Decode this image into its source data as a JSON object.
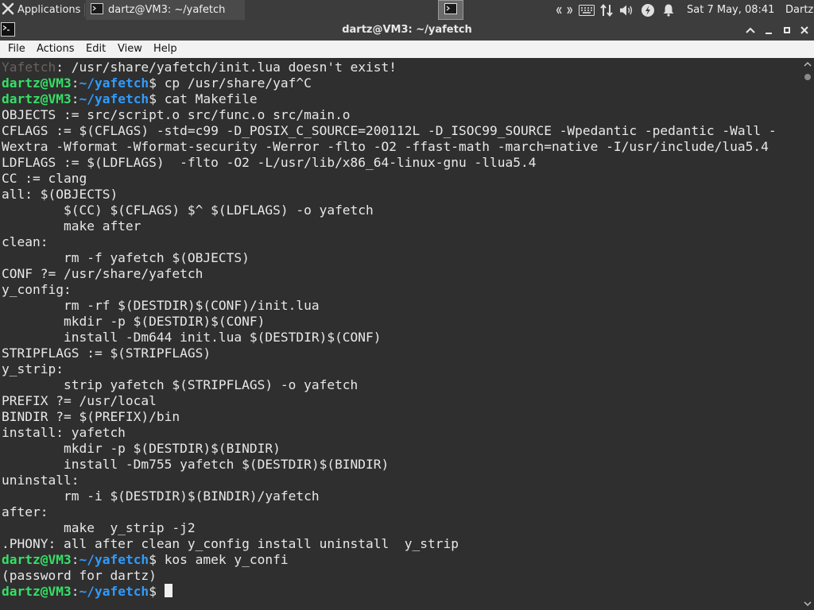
{
  "panel": {
    "apps_label": "Applications",
    "task_label": "dartz@VM3: ~/yafetch",
    "clock": "Sat  7 May, 08:41",
    "user": "Dartz"
  },
  "window": {
    "title": "dartz@VM3: ~/yafetch"
  },
  "menu": {
    "items": [
      "File",
      "Actions",
      "Edit",
      "View",
      "Help"
    ]
  },
  "terminal": {
    "prompt_user": "dartz@VM3",
    "prompt_sep": ":",
    "prompt_path": "~/yafetch",
    "prompt_end": "$ ",
    "lines": [
      {
        "type": "error",
        "prefix": "Yafetch",
        "text": ": /usr/share/yafetch/init.lua doesn't exist!"
      },
      {
        "type": "prompt",
        "text": "cp /usr/share/yaf^C"
      },
      {
        "type": "prompt",
        "text": "cat Makefile"
      },
      {
        "type": "out",
        "text": "OBJECTS := src/script.o src/func.o src/main.o"
      },
      {
        "type": "out",
        "text": "CFLAGS := $(CFLAGS) -std=c99 -D_POSIX_C_SOURCE=200112L -D_ISOC99_SOURCE -Wpedantic -pedantic -Wall -"
      },
      {
        "type": "out",
        "text": "Wextra -Wformat -Wformat-security -Werror -flto -O2 -ffast-math -march=native -I/usr/include/lua5.4"
      },
      {
        "type": "out",
        "text": "LDFLAGS := $(LDFLAGS)  -flto -O2 -L/usr/lib/x86_64-linux-gnu -llua5.4"
      },
      {
        "type": "out",
        "text": "CC := clang"
      },
      {
        "type": "out",
        "text": "all: $(OBJECTS)"
      },
      {
        "type": "out",
        "text": "        $(CC) $(CFLAGS) $^ $(LDFLAGS) -o yafetch"
      },
      {
        "type": "out",
        "text": "        make after"
      },
      {
        "type": "out",
        "text": "clean:"
      },
      {
        "type": "out",
        "text": "        rm -f yafetch $(OBJECTS)"
      },
      {
        "type": "out",
        "text": "CONF ?= /usr/share/yafetch"
      },
      {
        "type": "out",
        "text": "y_config:"
      },
      {
        "type": "out",
        "text": "        rm -rf $(DESTDIR)$(CONF)/init.lua"
      },
      {
        "type": "out",
        "text": "        mkdir -p $(DESTDIR)$(CONF)"
      },
      {
        "type": "out",
        "text": "        install -Dm644 init.lua $(DESTDIR)$(CONF)"
      },
      {
        "type": "out",
        "text": "STRIPFLAGS := $(STRIPFLAGS)"
      },
      {
        "type": "out",
        "text": "y_strip:"
      },
      {
        "type": "out",
        "text": "        strip yafetch $(STRIPFLAGS) -o yafetch"
      },
      {
        "type": "out",
        "text": "PREFIX ?= /usr/local"
      },
      {
        "type": "out",
        "text": "BINDIR ?= $(PREFIX)/bin"
      },
      {
        "type": "out",
        "text": "install: yafetch"
      },
      {
        "type": "out",
        "text": "        mkdir -p $(DESTDIR)$(BINDIR)"
      },
      {
        "type": "out",
        "text": "        install -Dm755 yafetch $(DESTDIR)$(BINDIR)"
      },
      {
        "type": "out",
        "text": "uninstall:"
      },
      {
        "type": "out",
        "text": "        rm -i $(DESTDIR)$(BINDIR)/yafetch"
      },
      {
        "type": "out",
        "text": "after:"
      },
      {
        "type": "out",
        "text": "        make  y_strip -j2"
      },
      {
        "type": "out",
        "text": ".PHONY: all after clean y_config install uninstall  y_strip"
      },
      {
        "type": "prompt",
        "text": "kos amek y_confi"
      },
      {
        "type": "out",
        "text": "(password for dartz)"
      },
      {
        "type": "prompt",
        "text": "",
        "cursor": true
      }
    ]
  }
}
